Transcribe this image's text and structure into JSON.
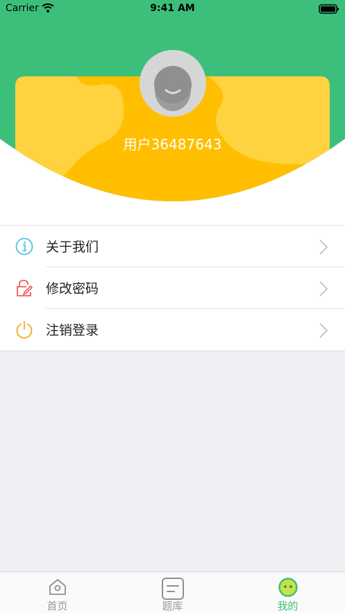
{
  "status_bar": {
    "carrier": "Carrier",
    "time": "9:41 AM"
  },
  "profile": {
    "username": "用户36487643"
  },
  "menu": [
    {
      "label": "关于我们",
      "icon": "info-icon"
    },
    {
      "label": "修改密码",
      "icon": "edit-lock-icon"
    },
    {
      "label": "注销登录",
      "icon": "power-icon"
    }
  ],
  "tabs": [
    {
      "label": "首页",
      "icon": "home-icon",
      "active": false
    },
    {
      "label": "题库",
      "icon": "question-bank-icon",
      "active": false
    },
    {
      "label": "我的",
      "icon": "mine-face-icon",
      "active": true
    }
  ],
  "colors": {
    "header_green": "#3dbf7c",
    "card_yellow": "#ffbf00",
    "card_light_yellow": "#ffd54a",
    "accent_green": "#3dbf7c",
    "info_blue": "#4fc3e8",
    "edit_red": "#ef5b5b",
    "power_orange": "#f5a623"
  }
}
